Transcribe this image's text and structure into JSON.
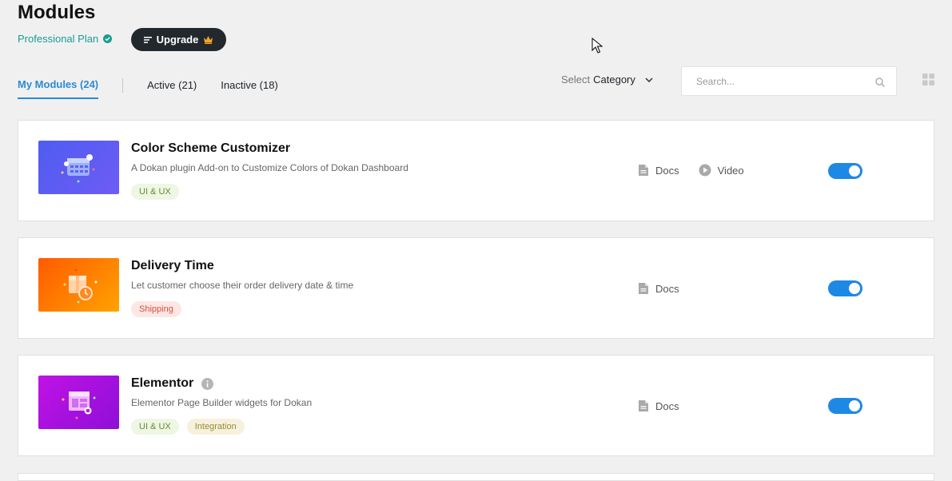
{
  "page": {
    "title": "Modules"
  },
  "plan": {
    "label": "Professional Plan",
    "upgrade_label": "Upgrade"
  },
  "tabs": [
    {
      "label": "My Modules (24)",
      "active": true
    },
    {
      "label": "Active (21)",
      "active": false
    },
    {
      "label": "Inactive (18)",
      "active": false
    }
  ],
  "filter": {
    "select_prefix": "Select",
    "select_value": "Category"
  },
  "search": {
    "placeholder": "Search...",
    "value": ""
  },
  "colors": {
    "accent": "#2b8ad6",
    "toggle_on": "#1e88e5",
    "plan": "#1a9d8f"
  },
  "modules": [
    {
      "title": "Color Scheme Customizer",
      "description": "A Dokan plugin Add-on to Customize Colors of Dokan Dashboard",
      "tags": [
        "UI & UX"
      ],
      "links": [
        "Docs",
        "Video"
      ],
      "enabled": true,
      "thumb_color": "#5a63f0",
      "thumb_icon": "calendar-palette-icon"
    },
    {
      "title": "Delivery Time",
      "description": "Let customer choose their order delivery date & time",
      "tags": [
        "Shipping"
      ],
      "links": [
        "Docs"
      ],
      "enabled": true,
      "thumb_color": "#ff7a00",
      "thumb_icon": "box-clock-icon"
    },
    {
      "title": "Elementor",
      "description": "Elementor Page Builder widgets for Dokan",
      "tags": [
        "UI & UX",
        "Integration"
      ],
      "links": [
        "Docs"
      ],
      "enabled": true,
      "thumb_color": "#b314e0",
      "thumb_icon": "page-builder-icon"
    }
  ]
}
